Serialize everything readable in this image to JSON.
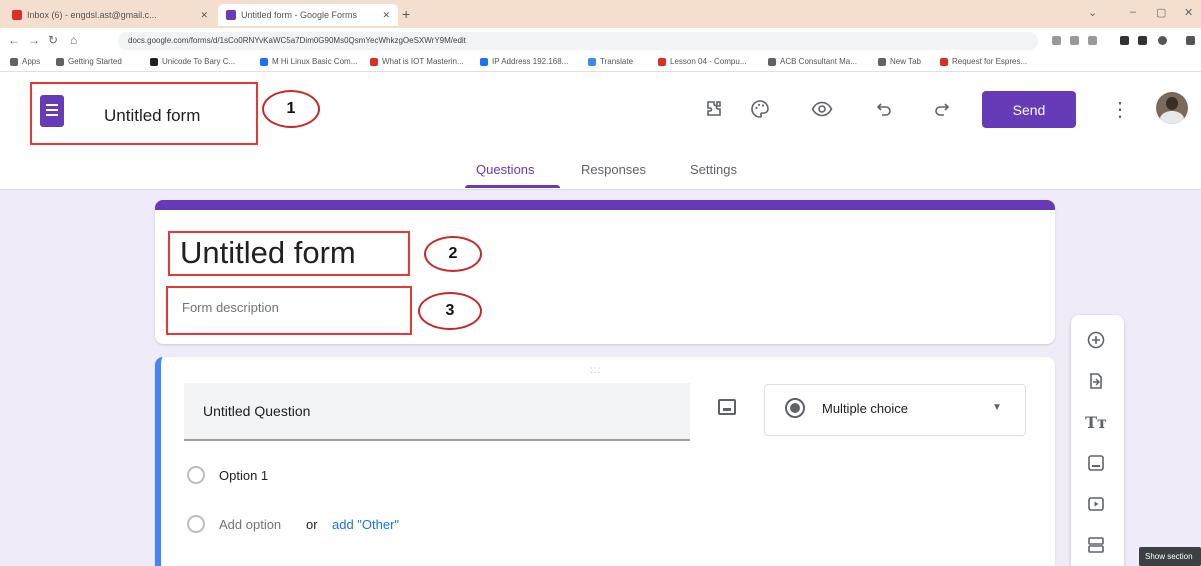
{
  "browser": {
    "tabs": [
      {
        "title": "Inbox (6) - engdsl.ast@gmail.c...",
        "favicon_color": "#d93025"
      },
      {
        "title": "Untitled form - Google Forms",
        "favicon_color": "#673ab7"
      }
    ],
    "new_tab": "+",
    "window_controls": [
      "⌄",
      "–",
      "▢",
      "✕"
    ],
    "url": "docs.google.com/forms/d/1sCo0RNYvKaWC5a7Dim0G90Ms0QsmYecWhkzgOeSXWrY9M/edit",
    "bookmarks": [
      {
        "label": "Apps",
        "color": "#5f6368"
      },
      {
        "label": "Getting Started",
        "color": "#5f6368"
      },
      {
        "label": "Unicode To Bary C...",
        "color": "#202124"
      },
      {
        "label": "M  Hi Linux Basic Com...",
        "color": "#1a73e8"
      },
      {
        "label": "What is IOT Masterin...",
        "color": "#d93025"
      },
      {
        "label": "IP Address 192.168...",
        "color": "#1a73e8"
      },
      {
        "label": "Translate",
        "color": "#4285f4"
      },
      {
        "label": "Lesson 04 - Compu...",
        "color": "#d93025"
      },
      {
        "label": "ACB Consultant Ma...",
        "color": "#5f6368"
      },
      {
        "label": "New Tab",
        "color": "#5f6368"
      },
      {
        "label": "Request for Espres...",
        "color": "#d93025"
      }
    ]
  },
  "header": {
    "doc_title": "Untitled form",
    "send_label": "Send",
    "icons": [
      "customize-addons-icon",
      "palette-icon",
      "preview-eye-icon",
      "undo-icon",
      "redo-icon",
      "more-vert-icon"
    ]
  },
  "nav": {
    "tabs": [
      {
        "label": "Questions",
        "active": true
      },
      {
        "label": "Responses",
        "active": false
      },
      {
        "label": "Settings",
        "active": false
      }
    ]
  },
  "form": {
    "title": "Untitled form",
    "description_placeholder": "Form description"
  },
  "question": {
    "title": "Untitled Question",
    "type": "Multiple choice",
    "options": [
      "Option 1"
    ],
    "add_option": "Add option",
    "or": "or",
    "add_other": "add \"Other\""
  },
  "callouts": [
    "1",
    "2",
    "3"
  ],
  "tooltip": "Show section",
  "colors": {
    "brand": "#673ab7",
    "question_accent": "#4285f4",
    "annotation": "#e53935"
  }
}
